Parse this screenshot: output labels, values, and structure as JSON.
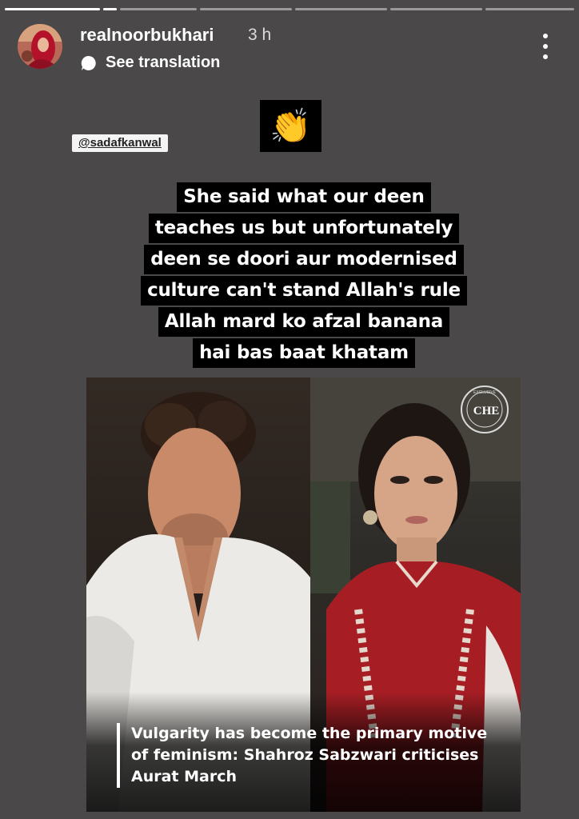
{
  "story": {
    "segments": [
      1,
      1,
      1,
      0.15,
      1,
      1,
      1
    ],
    "colors": {
      "background": "#4a4848",
      "progress_track": "#8b8989",
      "progress_fill": "#ffffff"
    }
  },
  "header": {
    "username": "realnoorbukhari",
    "time": "3 h",
    "translate_label": "See translation",
    "translate_icon": "speech-bubble-icon",
    "more_icon": "vertical-ellipsis-icon"
  },
  "sticker": {
    "emoji": "👏",
    "mention": "@sadafkanwal"
  },
  "caption": {
    "lines": [
      "She said what our deen",
      "teaches us but unfortunately",
      "deen se doori aur modernised",
      "culture can't stand Allah's rule",
      "Allah mard ko afzal  banana",
      "hai bas baat  khatam"
    ]
  },
  "news_card": {
    "headline_lines": [
      "Vulgarity has become the primary motive",
      "of feminism: Shahroz Sabzwari criticises",
      "Aurat March"
    ],
    "logo_text": "CHE",
    "logo_ring_text": "EXCLUSIVE"
  }
}
